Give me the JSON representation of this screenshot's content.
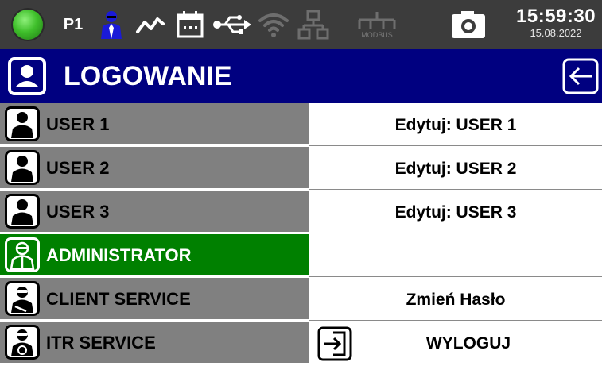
{
  "status_bar": {
    "indicator": "status-led-green",
    "profile_label": "P1",
    "icons": [
      "user-icon",
      "trend-icon",
      "calendar-icon",
      "usb-icon",
      "wifi-icon",
      "network-icon",
      "modbus-icon",
      "camera-icon"
    ],
    "modbus_label": "MODBUS",
    "time": "15:59:30",
    "date": "15.08.2022"
  },
  "header": {
    "title": "LOGOWANIE",
    "back_icon": "back-arrow-icon"
  },
  "users": [
    {
      "label": "USER 1",
      "icon": "user-icon",
      "action": "Edytuj: USER 1",
      "active": false
    },
    {
      "label": "USER 2",
      "icon": "user-icon",
      "action": "Edytuj: USER 2",
      "active": false
    },
    {
      "label": "USER 3",
      "icon": "user-icon",
      "action": "Edytuj: USER 3",
      "active": false
    },
    {
      "label": "ADMINISTRATOR",
      "icon": "admin-icon",
      "action": "",
      "active": true
    },
    {
      "label": "CLIENT SERVICE",
      "icon": "client-service-icon",
      "action": "Zmień Hasło",
      "active": false
    },
    {
      "label": "ITR SERVICE",
      "icon": "itr-service-icon",
      "action": "WYLOGUJ",
      "active": false
    }
  ],
  "logout_icon": "logout-icon",
  "colors": {
    "status_bar": "#3c3c3c",
    "title_bar": "#000080",
    "row_inactive": "#808080",
    "row_active": "#008000",
    "accent_blue": "#1a1ad8"
  }
}
